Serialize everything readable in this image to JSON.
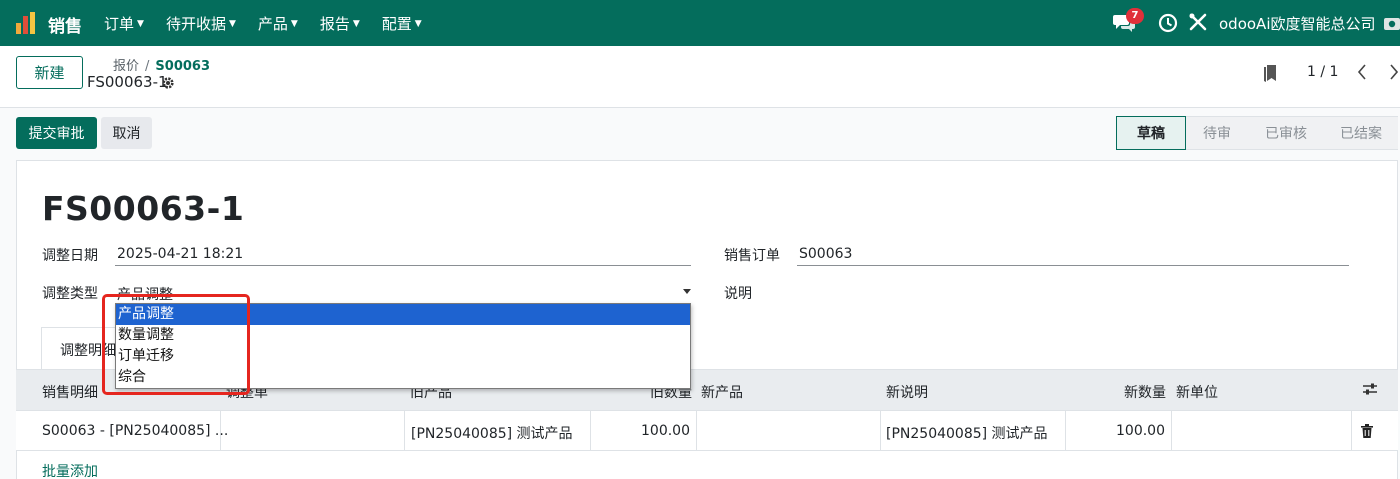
{
  "navbar": {
    "app_name": "销售",
    "menu": [
      "订单",
      "待开收据",
      "产品",
      "报告",
      "配置"
    ],
    "chat_badge": "7",
    "company": "odooAi欧度智能总公司",
    "color": "#046d5c"
  },
  "control": {
    "new_button": "新建",
    "breadcrumb_parent": "报价",
    "breadcrumb_sep": "/",
    "breadcrumb_current": "S00063",
    "record_name": "FS00063-1",
    "pager": "1 / 1"
  },
  "actions": {
    "submit": "提交审批",
    "cancel": "取消"
  },
  "status": [
    "草稿",
    "待审",
    "已审核",
    "已结案"
  ],
  "form": {
    "title": "FS00063-1",
    "date_label": "调整日期",
    "date_value": "2025-04-21 18:21",
    "order_label": "销售订单",
    "order_value": "S00063",
    "type_label": "调整类型",
    "type_value": "产品调整",
    "note_label": "说明"
  },
  "dropdown": {
    "options": [
      "产品调整",
      "数量调整",
      "订单迁移",
      "综合"
    ],
    "selected_index": 0
  },
  "tab": {
    "label": "调整明细"
  },
  "table": {
    "headers": [
      "销售明细",
      "调整单",
      "旧产品",
      "旧数量",
      "新产品",
      "新说明",
      "新数量",
      "新单位"
    ],
    "rows": [
      [
        "S00063 - [PN25040085] ...",
        "",
        "[PN25040085] 测试产品",
        "100.00",
        "",
        "[PN25040085] 测试产品",
        "100.00",
        ""
      ]
    ],
    "add_line": "批量添加"
  }
}
